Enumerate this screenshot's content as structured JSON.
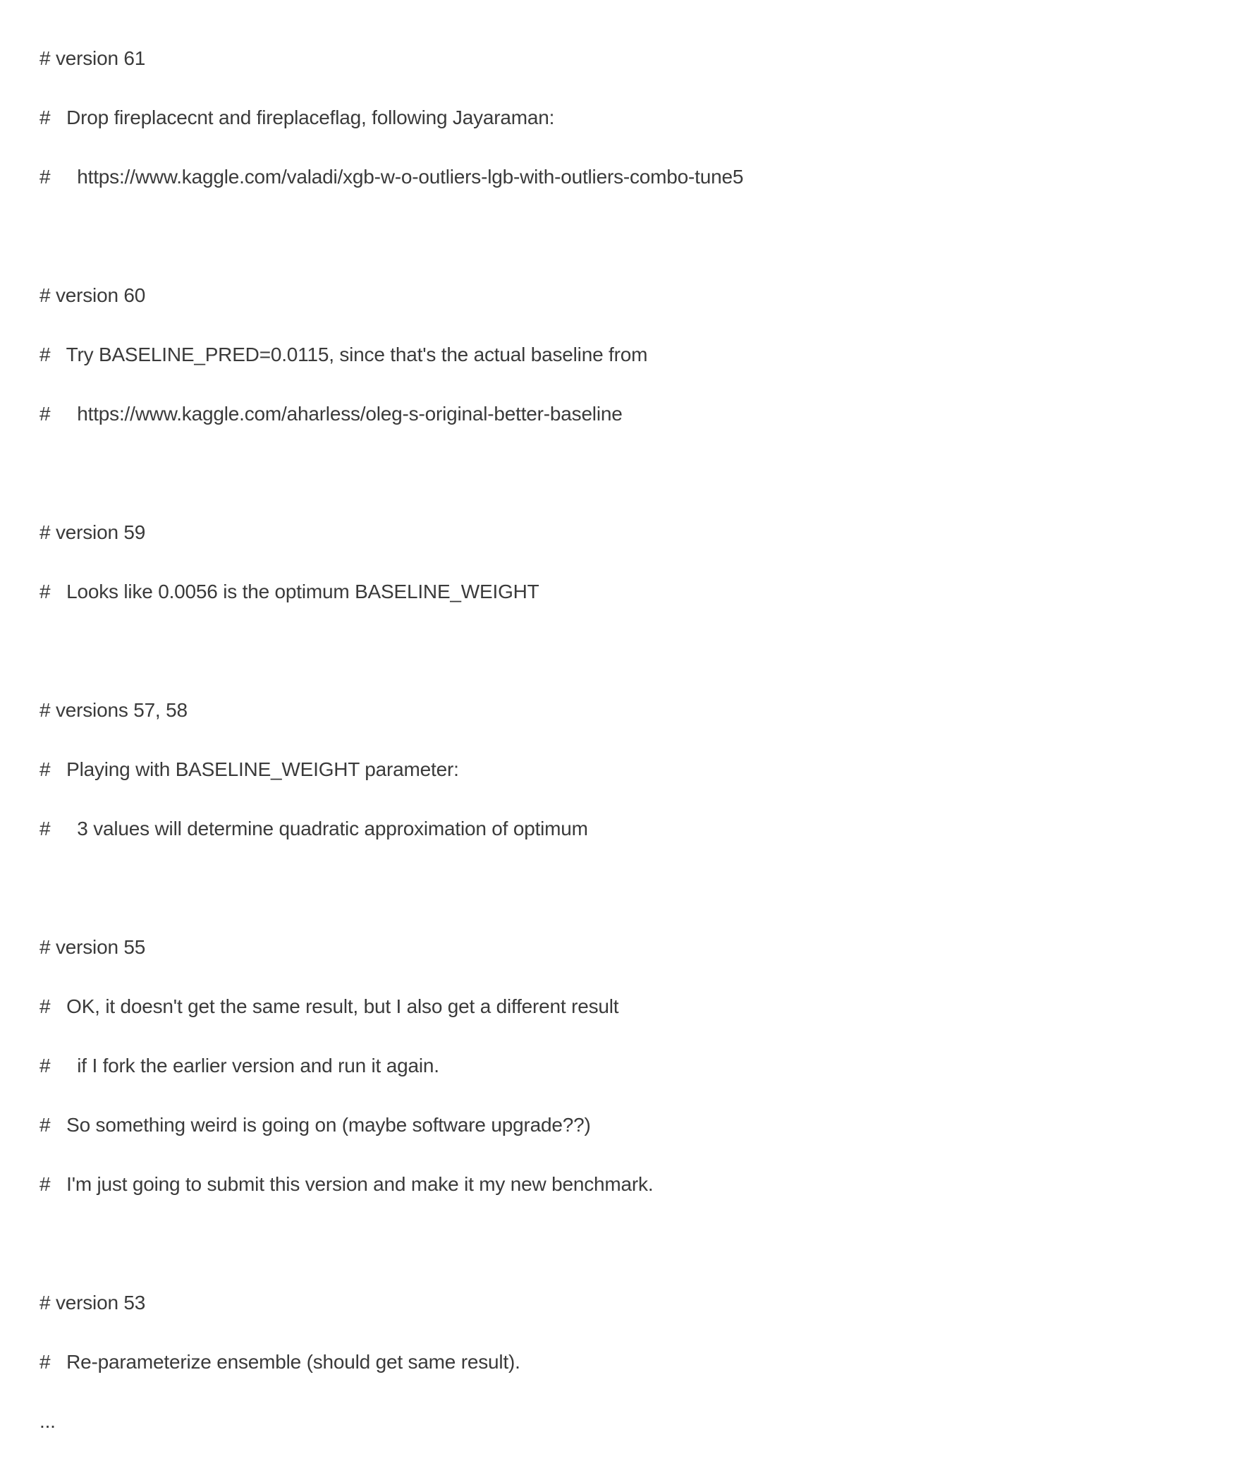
{
  "lines": [
    "# version 61",
    "#   Drop fireplacecnt and fireplaceflag, following Jayaraman:",
    "#     https://www.kaggle.com/valadi/xgb-w-o-outliers-lgb-with-outliers-combo-tune5",
    "",
    "# version 60",
    "#   Try BASELINE_PRED=0.0115, since that's the actual baseline from",
    "#     https://www.kaggle.com/aharless/oleg-s-original-better-baseline",
    "",
    "# version 59",
    "#   Looks like 0.0056 is the optimum BASELINE_WEIGHT",
    "",
    "# versions 57, 58",
    "#   Playing with BASELINE_WEIGHT parameter:",
    "#     3 values will determine quadratic approximation of optimum",
    "",
    "# version 55",
    "#   OK, it doesn't get the same result, but I also get a different result",
    "#     if I fork the earlier version and run it again.",
    "#   So something weird is going on (maybe software upgrade??)",
    "#   I'm just going to submit this version and make it my new benchmark.",
    "",
    "# version 53",
    "#   Re-parameterize ensemble (should get same result).",
    "..."
  ]
}
